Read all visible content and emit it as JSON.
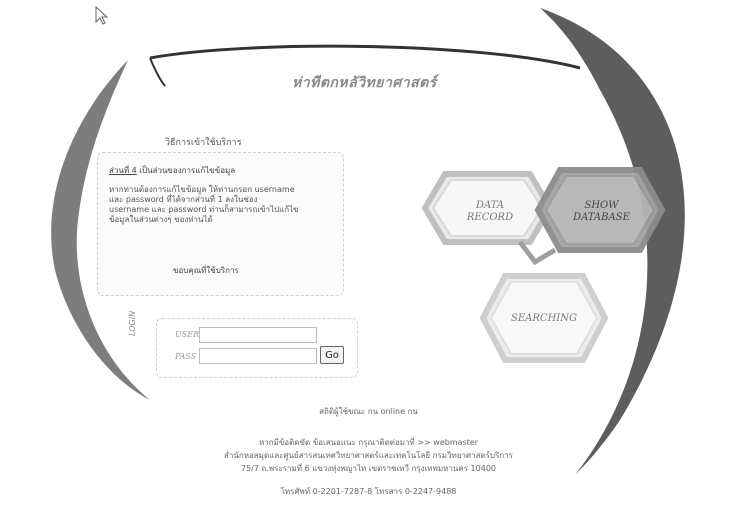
{
  "header": {
    "title": "ห่าทีตกหลัวิทยาศาสตร์"
  },
  "info_panel": {
    "heading": "วิธีการเข้าใช้บริการ",
    "subheading_prefix": "ส่วนที่ 4",
    "subheading_rest": " เป็นส่วนของการแก้ไขข้อมูล",
    "body": "หากท่านต้องการแก้ไขข้อมูล ให้ท่านกรอก username และ password ที่ได้จากส่วนที่ 1 ลงในช่อง username และ password ท่านก็สามารถเข้าไปแก้ไขข้อมูลในส่วนต่างๆ ของท่านได้",
    "thanks": "ขอบคุณที่ใช้บริการ"
  },
  "login": {
    "side_label": "LOGIN",
    "user_label": "USER",
    "pass_label": "PASS",
    "user_value": "",
    "pass_value": "",
    "go_label": "Go"
  },
  "menu": {
    "data_record": "DATA\nRECORD",
    "show_database": "SHOW\nDATABASE",
    "searching": "SEARCHING"
  },
  "online_text": "สถิติผู้ใช้ขณะ กน online กน",
  "footer": {
    "line1": "หากมีข้อติดขัด ข้อเสนอแนะ กรุณาติดต่อมาที่ >> webmaster",
    "line2": "สำนักหอสมุดและศูนย์สารสนเทศวิทยาศาสตร์และเทคโนโลยี กรมวิทยาศาสตร์บริการ",
    "line3": "75/7 ถ.พระรามที่ 6 แขวงทุ่งพญาไท เขตราชเทวี กรุงเทพมหานคร 10400",
    "line4": "โทรศัพท์ 0-2201-7287-8 โทรสาร 0-2247-9488"
  }
}
